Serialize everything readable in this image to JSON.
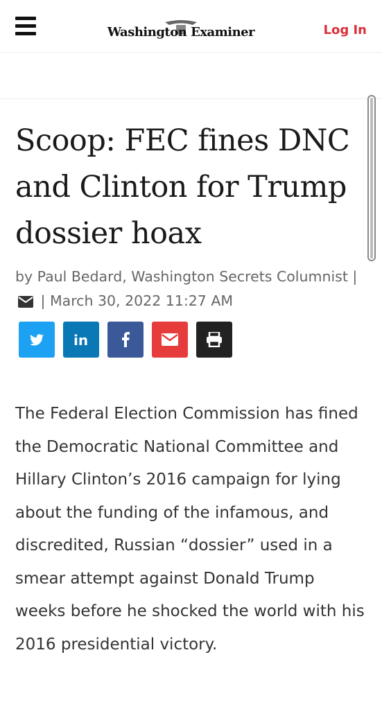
{
  "header": {
    "logo_text": "Washington Examiner",
    "login_label": "Log In",
    "menu_icon": "hamburger-menu-icon"
  },
  "article": {
    "headline": "Scoop: FEC fines DNC and Clinton for Trump dossier hoax",
    "byline_prefix": "by Paul Bedard, Washington Secrets Columnist |",
    "byline_date": "| March 30, 2022 11:27 AM",
    "share_buttons": [
      "twitter-icon",
      "linkedin-icon",
      "facebook-icon",
      "email-icon",
      "print-icon"
    ],
    "body": "The Federal Election Commission has fined the Democratic National Committee and Hillary Clinton’s 2016 campaign for lying about the funding of the infamous, and discredited, Russian “dossier” used in a smear attempt against Donald Trump weeks before he shocked the world with his 2016 presidential victory."
  },
  "colors": {
    "login": "#d9303b",
    "twitter": "#1da1f2",
    "linkedin": "#0a78b5",
    "facebook": "#3b5998",
    "email": "#e73c3c",
    "print": "#222222"
  }
}
